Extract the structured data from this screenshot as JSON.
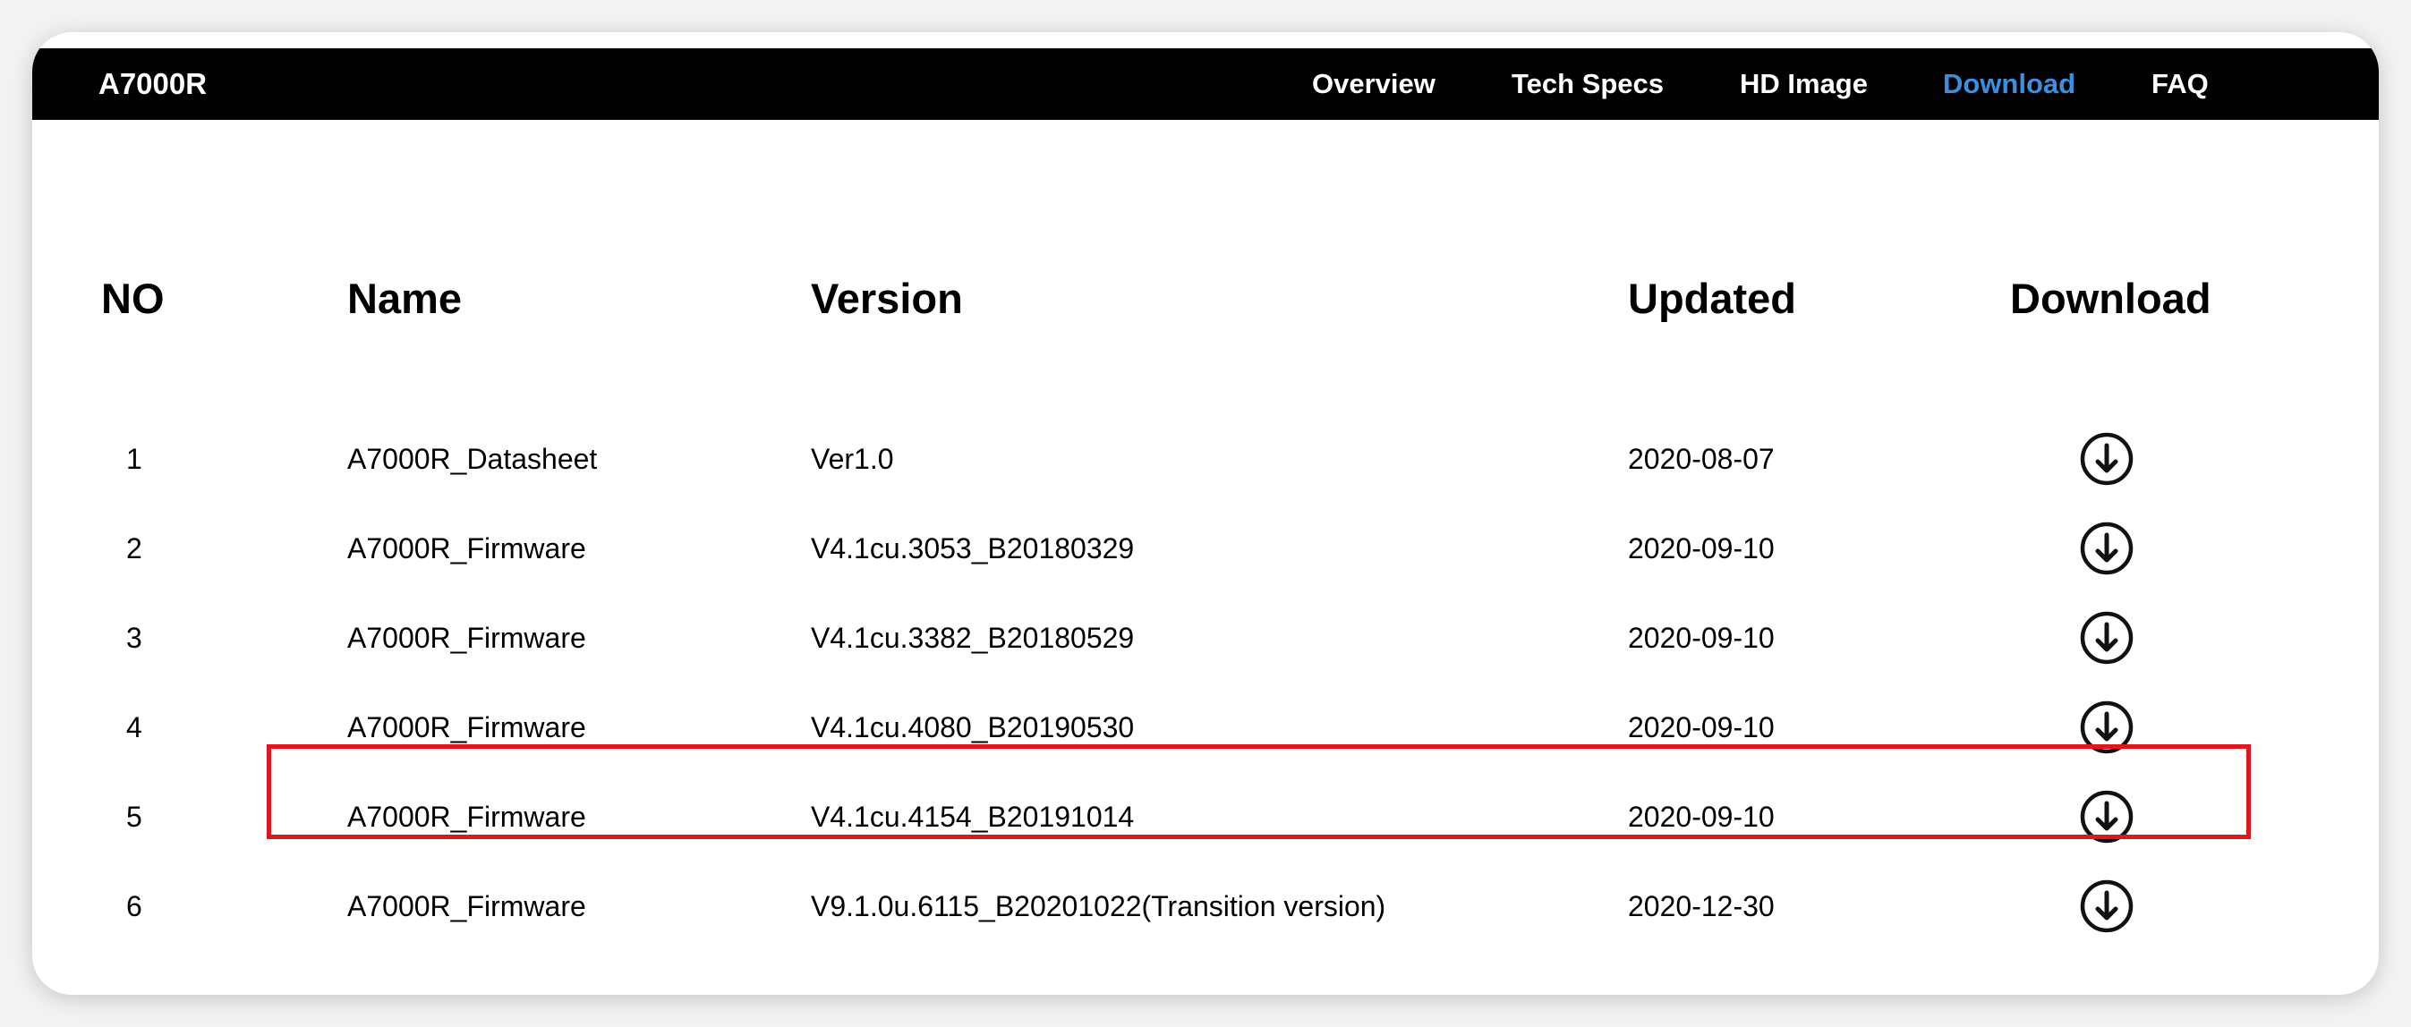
{
  "brand": "A7000R",
  "nav": [
    {
      "label": "Overview",
      "active": false
    },
    {
      "label": "Tech Specs",
      "active": false
    },
    {
      "label": "HD Image",
      "active": false
    },
    {
      "label": "Download",
      "active": true
    },
    {
      "label": "FAQ",
      "active": false
    }
  ],
  "table": {
    "headers": {
      "no": "NO",
      "name": "Name",
      "version": "Version",
      "updated": "Updated",
      "download": "Download"
    },
    "rows": [
      {
        "no": "1",
        "name": "A7000R_Datasheet",
        "version": "Ver1.0",
        "updated": "2020-08-07",
        "highlighted": false
      },
      {
        "no": "2",
        "name": "A7000R_Firmware",
        "version": "V4.1cu.3053_B20180329",
        "updated": "2020-09-10",
        "highlighted": false
      },
      {
        "no": "3",
        "name": "A7000R_Firmware",
        "version": "V4.1cu.3382_B20180529",
        "updated": "2020-09-10",
        "highlighted": false
      },
      {
        "no": "4",
        "name": "A7000R_Firmware",
        "version": "V4.1cu.4080_B20190530",
        "updated": "2020-09-10",
        "highlighted": false
      },
      {
        "no": "5",
        "name": "A7000R_Firmware",
        "version": "V4.1cu.4154_B20191014",
        "updated": "2020-09-10",
        "highlighted": true
      },
      {
        "no": "6",
        "name": "A7000R_Firmware",
        "version": "V9.1.0u.6115_B20201022(Transition version)",
        "updated": "2020-12-30",
        "highlighted": false
      }
    ],
    "download_icon": "download-circle-icon"
  },
  "colors": {
    "navbar_bg": "#000000",
    "nav_text": "#ffffff",
    "nav_active": "#3a8fe0",
    "highlight_border": "#e0161e"
  }
}
